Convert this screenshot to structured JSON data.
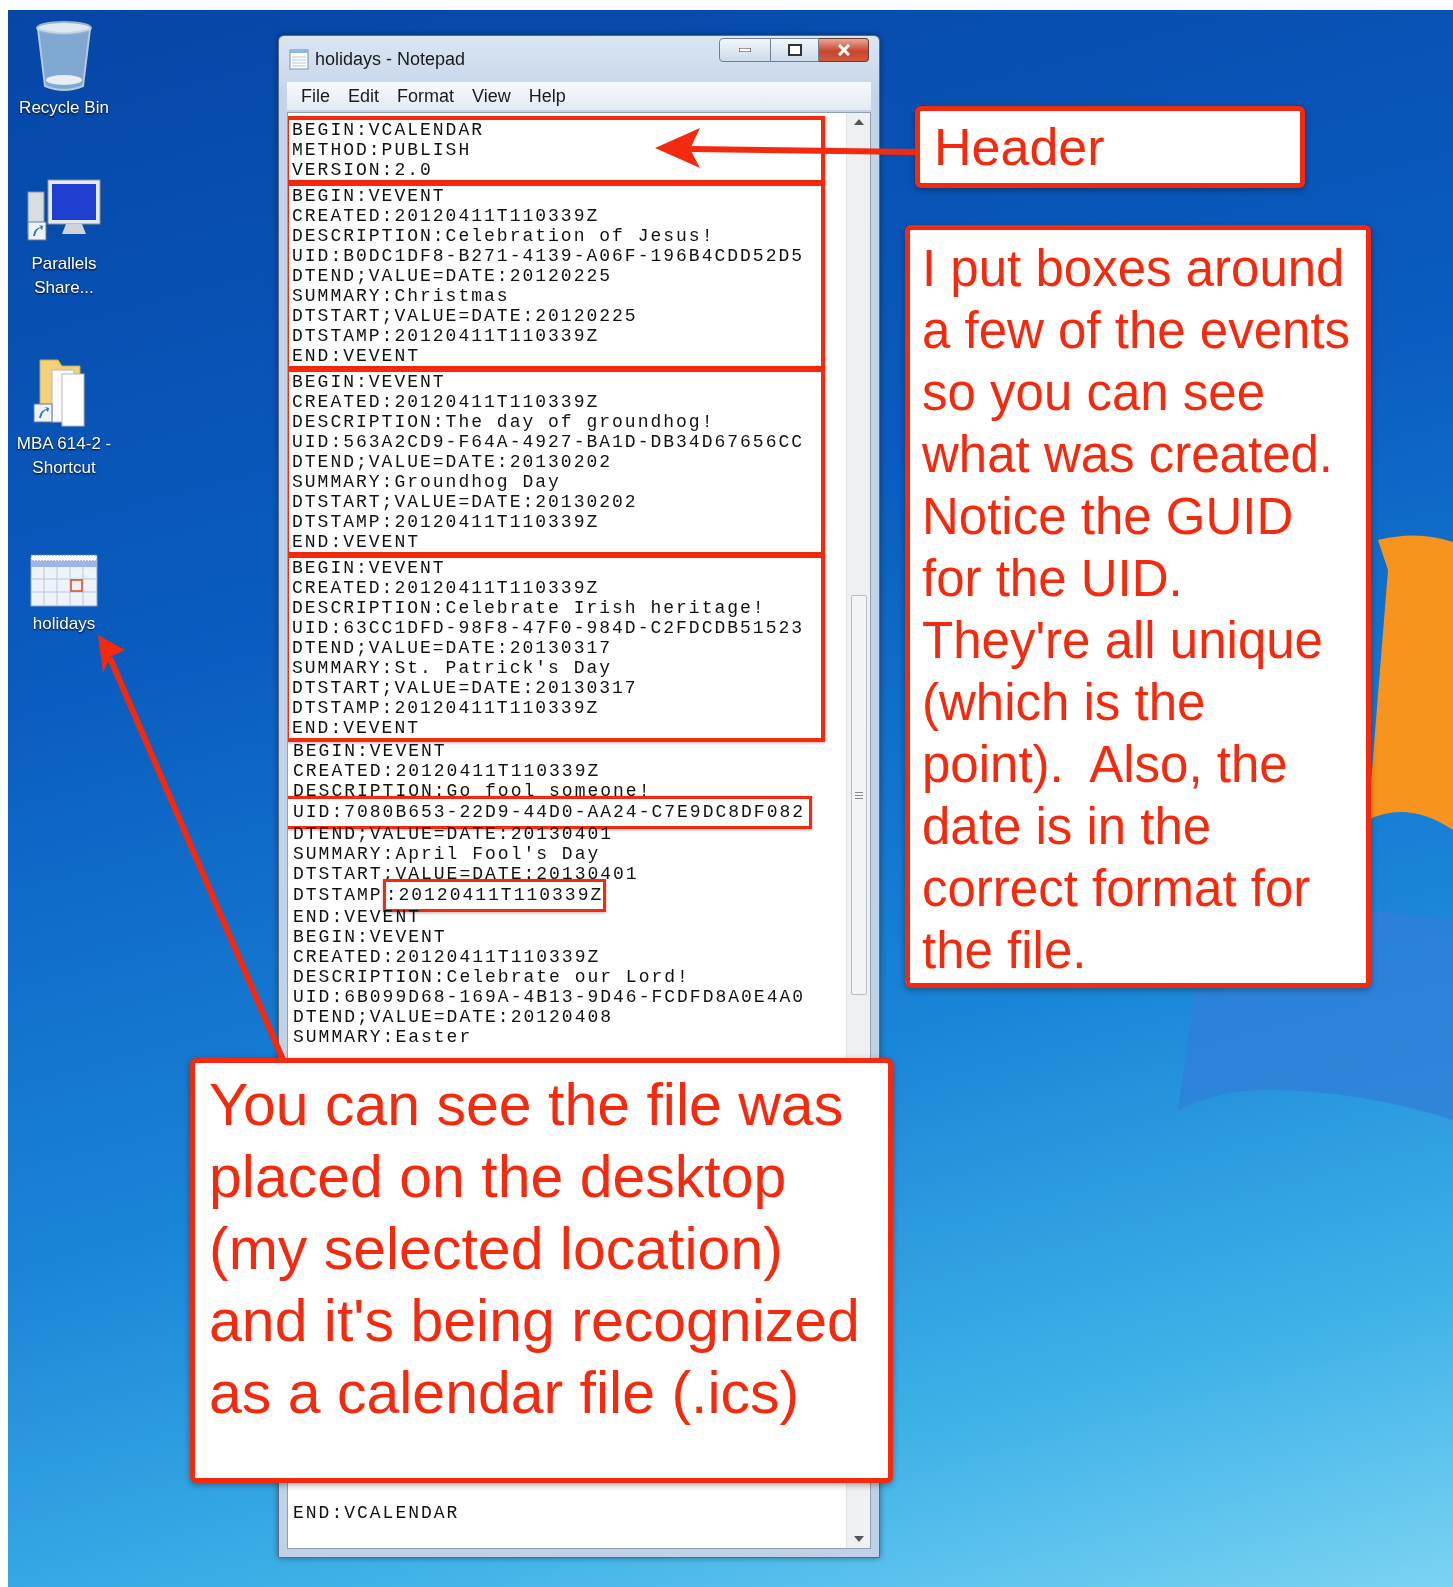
{
  "desktop": {
    "icons": [
      {
        "label": "Recycle Bin",
        "kind": "recycle"
      },
      {
        "label": "Parallels Share...",
        "kind": "monitor"
      },
      {
        "label": "MBA 614-2 - Shortcut",
        "kind": "folder"
      },
      {
        "label": "holidays",
        "kind": "calendar"
      }
    ]
  },
  "notepad": {
    "title": "holidays - Notepad",
    "menu": [
      "File",
      "Edit",
      "Format",
      "View",
      "Help"
    ],
    "blocks": [
      {
        "boxed": true,
        "lines": [
          {
            "text": "BEGIN:VCALENDAR"
          },
          {
            "text": "METHOD:PUBLISH"
          },
          {
            "text": "VERSION:2.0"
          }
        ]
      },
      {
        "boxed": true,
        "lines": [
          {
            "text": "BEGIN:VEVENT"
          },
          {
            "text": "CREATED:20120411T110339Z"
          },
          {
            "text": "DESCRIPTION:Celebration of Jesus!"
          },
          {
            "text": "UID:B0DC1DF8-B271-4139-A06F-196B4CDD52D5"
          },
          {
            "text": "DTEND;VALUE=DATE:20120225"
          },
          {
            "text": "SUMMARY:Christmas"
          },
          {
            "text": "DTSTART;VALUE=DATE:20120225"
          },
          {
            "text": "DTSTAMP:20120411T110339Z"
          },
          {
            "text": "END:VEVENT"
          }
        ]
      },
      {
        "boxed": true,
        "lines": [
          {
            "text": "BEGIN:VEVENT"
          },
          {
            "text": "CREATED:20120411T110339Z"
          },
          {
            "text": "DESCRIPTION:The day of groundhog!"
          },
          {
            "text": "UID:563A2CD9-F64A-4927-BA1D-DB34D67656CC"
          },
          {
            "text": "DTEND;VALUE=DATE:20130202"
          },
          {
            "text": "SUMMARY:Groundhog Day"
          },
          {
            "text": "DTSTART;VALUE=DATE:20130202"
          },
          {
            "text": "DTSTAMP:20120411T110339Z"
          },
          {
            "text": "END:VEVENT"
          }
        ]
      },
      {
        "boxed": true,
        "lines": [
          {
            "text": "BEGIN:VEVENT"
          },
          {
            "text": "CREATED:20120411T110339Z"
          },
          {
            "text": "DESCRIPTION:Celebrate Irish heritage!"
          },
          {
            "text": "UID:63CC1DFD-98F8-47F0-984D-C2FDCDB51523"
          },
          {
            "text": "DTEND;VALUE=DATE:20130317"
          },
          {
            "text": "SUMMARY:St. Patrick's Day"
          },
          {
            "text": "DTSTART;VALUE=DATE:20130317"
          },
          {
            "text": "DTSTAMP:20120411T110339Z"
          },
          {
            "text": "END:VEVENT"
          }
        ]
      },
      {
        "boxed": false,
        "lines": [
          {
            "text": "BEGIN:VEVENT"
          },
          {
            "text": "CREATED:20120411T110339Z"
          },
          {
            "text": "DESCRIPTION:Go fool someone!"
          },
          {
            "text": "UID:7080B653-22D9-44D0-AA24-C7E9DC8DF082",
            "boxed": true
          },
          {
            "text": "DTEND;VALUE=DATE:20130401"
          },
          {
            "text": "SUMMARY:April Fool's Day"
          },
          {
            "text": "DTSTART;VALUE=DATE:20130401"
          },
          {
            "text": "DTSTAMP",
            "value": ":20120411T110339Z",
            "value_boxed": true
          },
          {
            "text": "END:VEVENT"
          },
          {
            "text": "BEGIN:VEVENT"
          },
          {
            "text": "CREATED:20120411T110339Z"
          },
          {
            "text": "DESCRIPTION:Celebrate our Lord!"
          },
          {
            "text": "UID:6B099D68-169A-4B13-9D46-FCDFD8A0E4A0"
          },
          {
            "text": "DTEND;VALUE=DATE:20120408"
          },
          {
            "text": "SUMMARY:Easter"
          }
        ]
      }
    ],
    "tail_lines": [
      "END:VCALENDAR"
    ]
  },
  "callouts": [
    {
      "kind": "header",
      "text": "Header"
    },
    {
      "kind": "side",
      "text": "I put boxes around\na few of the events\nso you can see\nwhat was created.\nNotice the GUID\nfor the UID.\nThey're all unique\n(which is the\npoint).  Also, the\ndate is in the\ncorrect format for\nthe file."
    },
    {
      "kind": "bottom",
      "text": "You can see the file was\nplaced on the desktop\n(my selected location)\nand it's being recognized\nas a calendar file (.ics)"
    }
  ]
}
